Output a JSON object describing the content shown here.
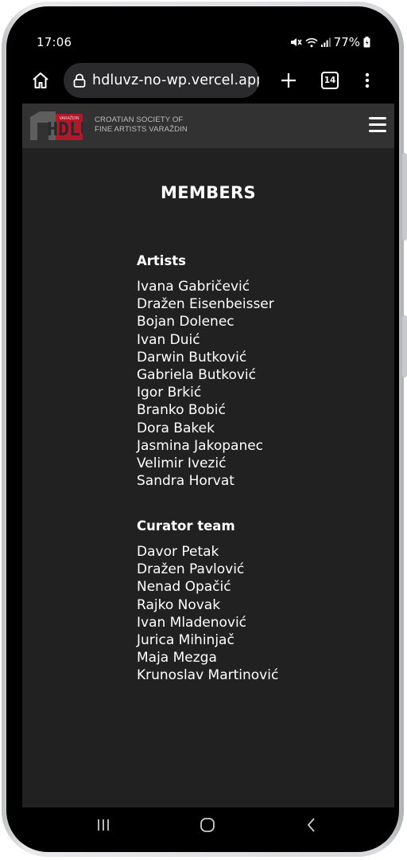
{
  "status_bar": {
    "time": "17:06",
    "battery": "77%"
  },
  "browser": {
    "url": "hdluvz-no-wp.vercel.app/",
    "tab_count": "14"
  },
  "site": {
    "logo_text": "HDLU",
    "logo_subtext": "VARAŽDIN",
    "name_line1": "CROATIAN SOCIETY OF",
    "name_line2": "FINE ARTISTS VARAŽDIN"
  },
  "page": {
    "title": "MEMBERS",
    "groups": [
      {
        "heading": "Artists",
        "members": [
          "Ivana Gabričević",
          "Dražen Eisenbeisser",
          "Bojan Dolenec",
          "Ivan Duić",
          "Darwin Butković",
          "Gabriela Butković",
          "Igor Brkić",
          "Branko Bobić",
          "Dora Bakek",
          "Jasmina Jakopanec",
          "Velimir Ivezić",
          "Sandra Horvat"
        ]
      },
      {
        "heading": "Curator team",
        "members": [
          "Davor Petak",
          "Dražen Pavlović",
          "Nenad Opačić",
          "Rajko Novak",
          "Ivan Mladenović",
          "Jurica Mihinjač",
          "Maja Mezga",
          "Krunoslav Martinović"
        ]
      }
    ]
  },
  "colors": {
    "page_background": "#212121",
    "header_background": "#323232",
    "logo_red": "#b3182a",
    "logo_gray": "#5e5e5e"
  }
}
